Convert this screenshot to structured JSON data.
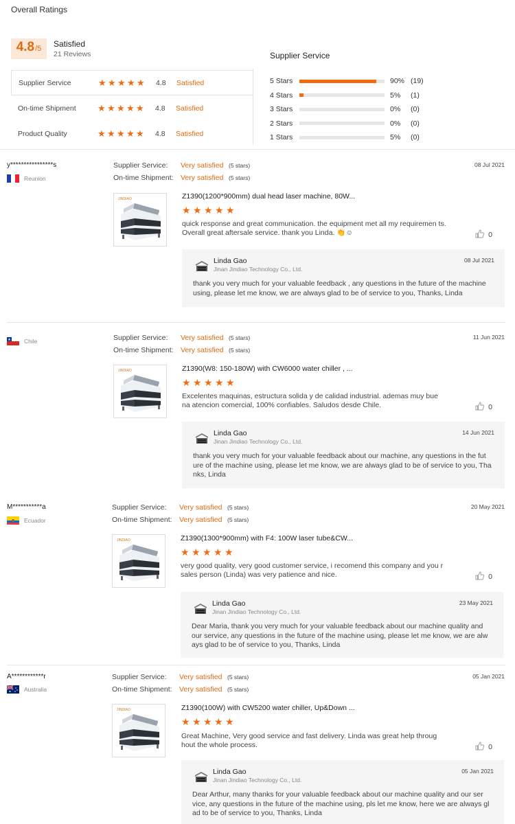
{
  "header": {
    "title": "Overall Ratings"
  },
  "overall": {
    "score": "4.8",
    "out_of": "/5",
    "label": "Satisfied",
    "count": "21 Reviews"
  },
  "ratings": [
    {
      "label": "Supplier Service",
      "value": "4.8",
      "status": "Satisfied",
      "stars": 5
    },
    {
      "label": "On-time Shipment",
      "value": "4.8",
      "status": "Satisfied",
      "stars": 5
    },
    {
      "label": "Product Quality",
      "value": "4.8",
      "status": "Satisfied",
      "stars": 5
    }
  ],
  "supplier_service": {
    "title": "Supplier Service",
    "distribution": [
      {
        "label": "5 Stars",
        "percent": "90%",
        "count": "(19)",
        "fraction": 0.9
      },
      {
        "label": "4 Stars",
        "percent": "5%",
        "count": "(1)",
        "fraction": 0.05
      },
      {
        "label": "3 Stars",
        "percent": "0%",
        "count": "(0)",
        "fraction": 0
      },
      {
        "label": "2 Stars",
        "percent": "0%",
        "count": "(0)",
        "fraction": 0
      },
      {
        "label": "1 Stars",
        "percent": "5%",
        "count": "(0)",
        "fraction": 0
      }
    ]
  },
  "labels": {
    "supplier_service": "Supplier Service:",
    "ontime_shipment": "On-time Shipment:",
    "very_satisfied": "Very satisfied",
    "five_stars": "(5 stars)"
  },
  "reviews": [
    {
      "user": "y****************s",
      "country": "Reunion",
      "flag": "france",
      "date": "08 Jul 2021",
      "product": "Z1390(1200*900mm) dual head laser machine, 80W...",
      "stars": 5,
      "comment": "quick response and great communication. the equipment met all my requiremen ts. Overall great aftersale service. thank you Linda. 👏☺",
      "likes": "0",
      "reply": {
        "name": "Linda Gao",
        "company": "Jinan Jindiao Technology Co., Ltd.",
        "date": "08 Jul 2021",
        "text": "thank you very much for your valuable feedback , any questions in the future of the machine using, please let me know, we are always glad to be of service to you, Thanks, Linda"
      }
    },
    {
      "user": "",
      "country": "Chile",
      "flag": "chile",
      "date": "11 Jun 2021",
      "product": "Z1390(W8: 150-180W) with CW6000 water chiller , ...",
      "stars": 5,
      "comment": "Excelentes maquinas, estructura solida y de calidad industrial. ademas muy bue na atencion comercial, 100% confiables. Saludos desde Chile.",
      "likes": "0",
      "reply": {
        "name": "Linda Gao",
        "company": "Jinan Jindiao Technology Co., Ltd.",
        "date": "14 Jun 2021",
        "text": "thank you very much for your valuable feedback about our machine, any questions in the fut ure of the machine using, please let me know, we are always glad to be of service to you, Tha nks, Linda"
      }
    },
    {
      "user": "M***********a",
      "country": "Ecuador",
      "flag": "ecuador",
      "date": "20 May 2021",
      "product": "Z1390(1300*900mm) with F4: 100W laser tube&CW...",
      "stars": 5,
      "comment": "very good quality, very good customer service, i recomend this company and you r sales person (Linda) was very patience and nice.",
      "likes": "0",
      "reply": {
        "name": "Linda Gao",
        "company": "Jinan Jindiao Technology Co., Ltd.",
        "date": "23 May 2021",
        "text": "Dear Maria, thank you very much for your valuable feedback about our machine quality and our service, any questions in the future of the machine using, please let me know, we are alw ays glad to be of service to you, Thanks, Linda"
      }
    },
    {
      "user": "A************r",
      "country": "Australia",
      "flag": "australia",
      "date": "05 Jan 2021",
      "product": "Z1390(100W) with CW5200 water chiller, Up&Down ...",
      "stars": 5,
      "comment": "Great Machine, Very good service and fast delivery. Linda was great help throug hout the whole process.",
      "likes": "0",
      "reply": {
        "name": "Linda Gao",
        "company": "Jinan Jindiao Technology Co., Ltd.",
        "date": "05 Jan 2021",
        "text": "Dear Arthur, many thanks for your valuable feedback about our machine quality and our ser vice, any questions in the future of the machine using, pls let me know, here we are always gl ad to be of service to you, Thanks, Linda"
      }
    }
  ]
}
